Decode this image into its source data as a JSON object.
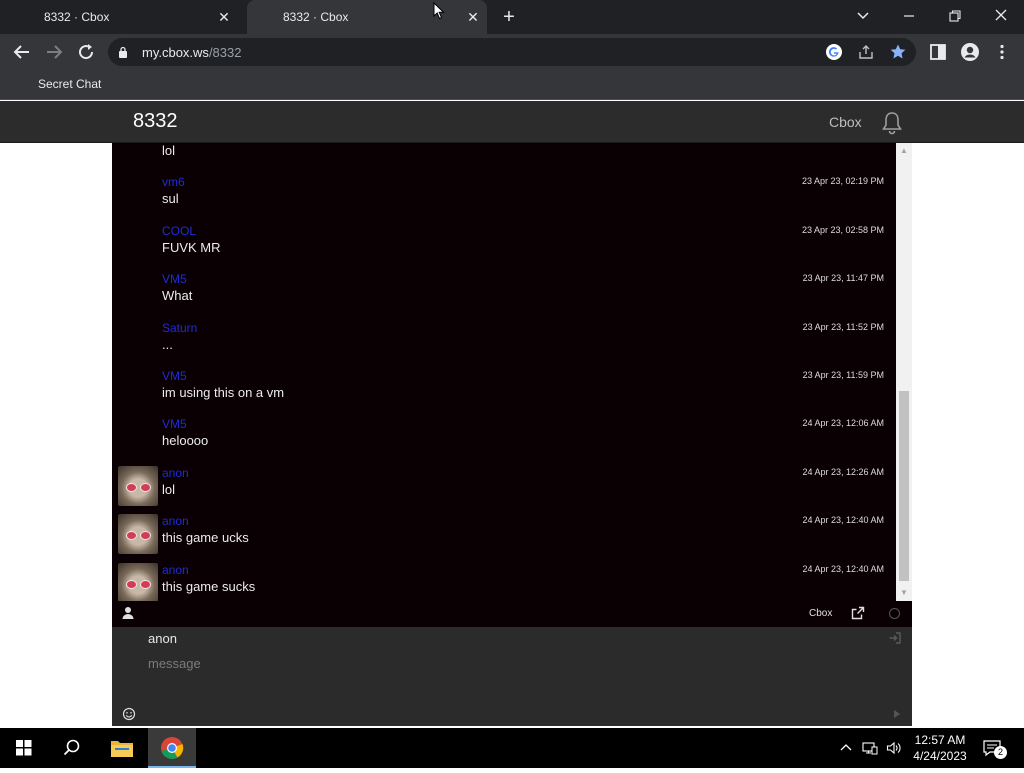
{
  "browser": {
    "tabs": [
      {
        "title": "8332 · Cbox",
        "active": false
      },
      {
        "title": "8332 · Cbox",
        "active": true
      }
    ],
    "url_host": "my.cbox.ws",
    "url_path": "/8332",
    "bookmark": "Secret Chat"
  },
  "site": {
    "title": "8332",
    "brand": "Cbox"
  },
  "messages": [
    {
      "name": "",
      "text": "lol",
      "time": "",
      "avatar": false
    },
    {
      "name": "vm6",
      "text": "sul",
      "time": "23 Apr 23, 02:19 PM",
      "avatar": false
    },
    {
      "name": "COOL",
      "text": "FUVK MR",
      "time": "23 Apr 23, 02:58 PM",
      "avatar": false
    },
    {
      "name": "VM5",
      "text": "What",
      "time": "23 Apr 23, 11:47 PM",
      "avatar": false
    },
    {
      "name": "Saturn",
      "text": "...",
      "time": "23 Apr 23, 11:52 PM",
      "avatar": false
    },
    {
      "name": "VM5",
      "text": "im using this on a vm",
      "time": "23 Apr 23, 11:59 PM",
      "avatar": false
    },
    {
      "name": "VM5",
      "text": "heloooo",
      "time": "24 Apr 23, 12:06 AM",
      "avatar": false
    },
    {
      "name": "anon",
      "text": "lol",
      "time": "24 Apr 23, 12:26 AM",
      "avatar": true
    },
    {
      "name": "anon",
      "text": "this game ucks",
      "time": "24 Apr 23, 12:40 AM",
      "avatar": true
    },
    {
      "name": "anon",
      "text": "this game sucks",
      "time": "24 Apr 23, 12:40 AM",
      "avatar": true
    }
  ],
  "chatbar": {
    "brand": "Cbox"
  },
  "compose": {
    "name_value": "anon",
    "message_placeholder": "message"
  },
  "taskbar": {
    "time": "12:57 AM",
    "date": "4/24/2023",
    "notification_count": "2"
  },
  "colors": {
    "chat_bg": "#0a0003",
    "username": "#1f2bd8",
    "header_bg": "#2c2c2c"
  }
}
